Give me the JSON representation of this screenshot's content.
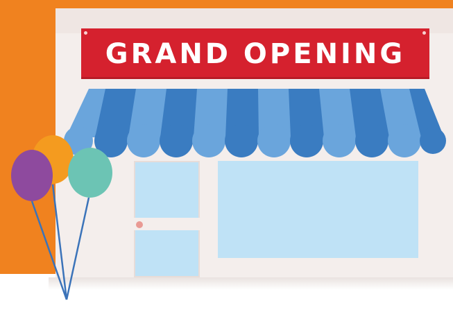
{
  "banner": {
    "text": "GRAND OPENING"
  },
  "colors": {
    "background_orange": "#f0821f",
    "storefront": "#f4eeec",
    "banner_red": "#d5212e",
    "awning_dark_blue": "#3a7cc1",
    "awning_light_blue": "#6aa5dc",
    "window_blue": "#bfe2f6",
    "balloon_purple": "#8e4a9e",
    "balloon_orange": "#f49b1f",
    "balloon_teal": "#6cc4b4",
    "balloon_string": "#3b73b9"
  },
  "icons": [
    "storefront-illustration",
    "awning",
    "balloons"
  ]
}
